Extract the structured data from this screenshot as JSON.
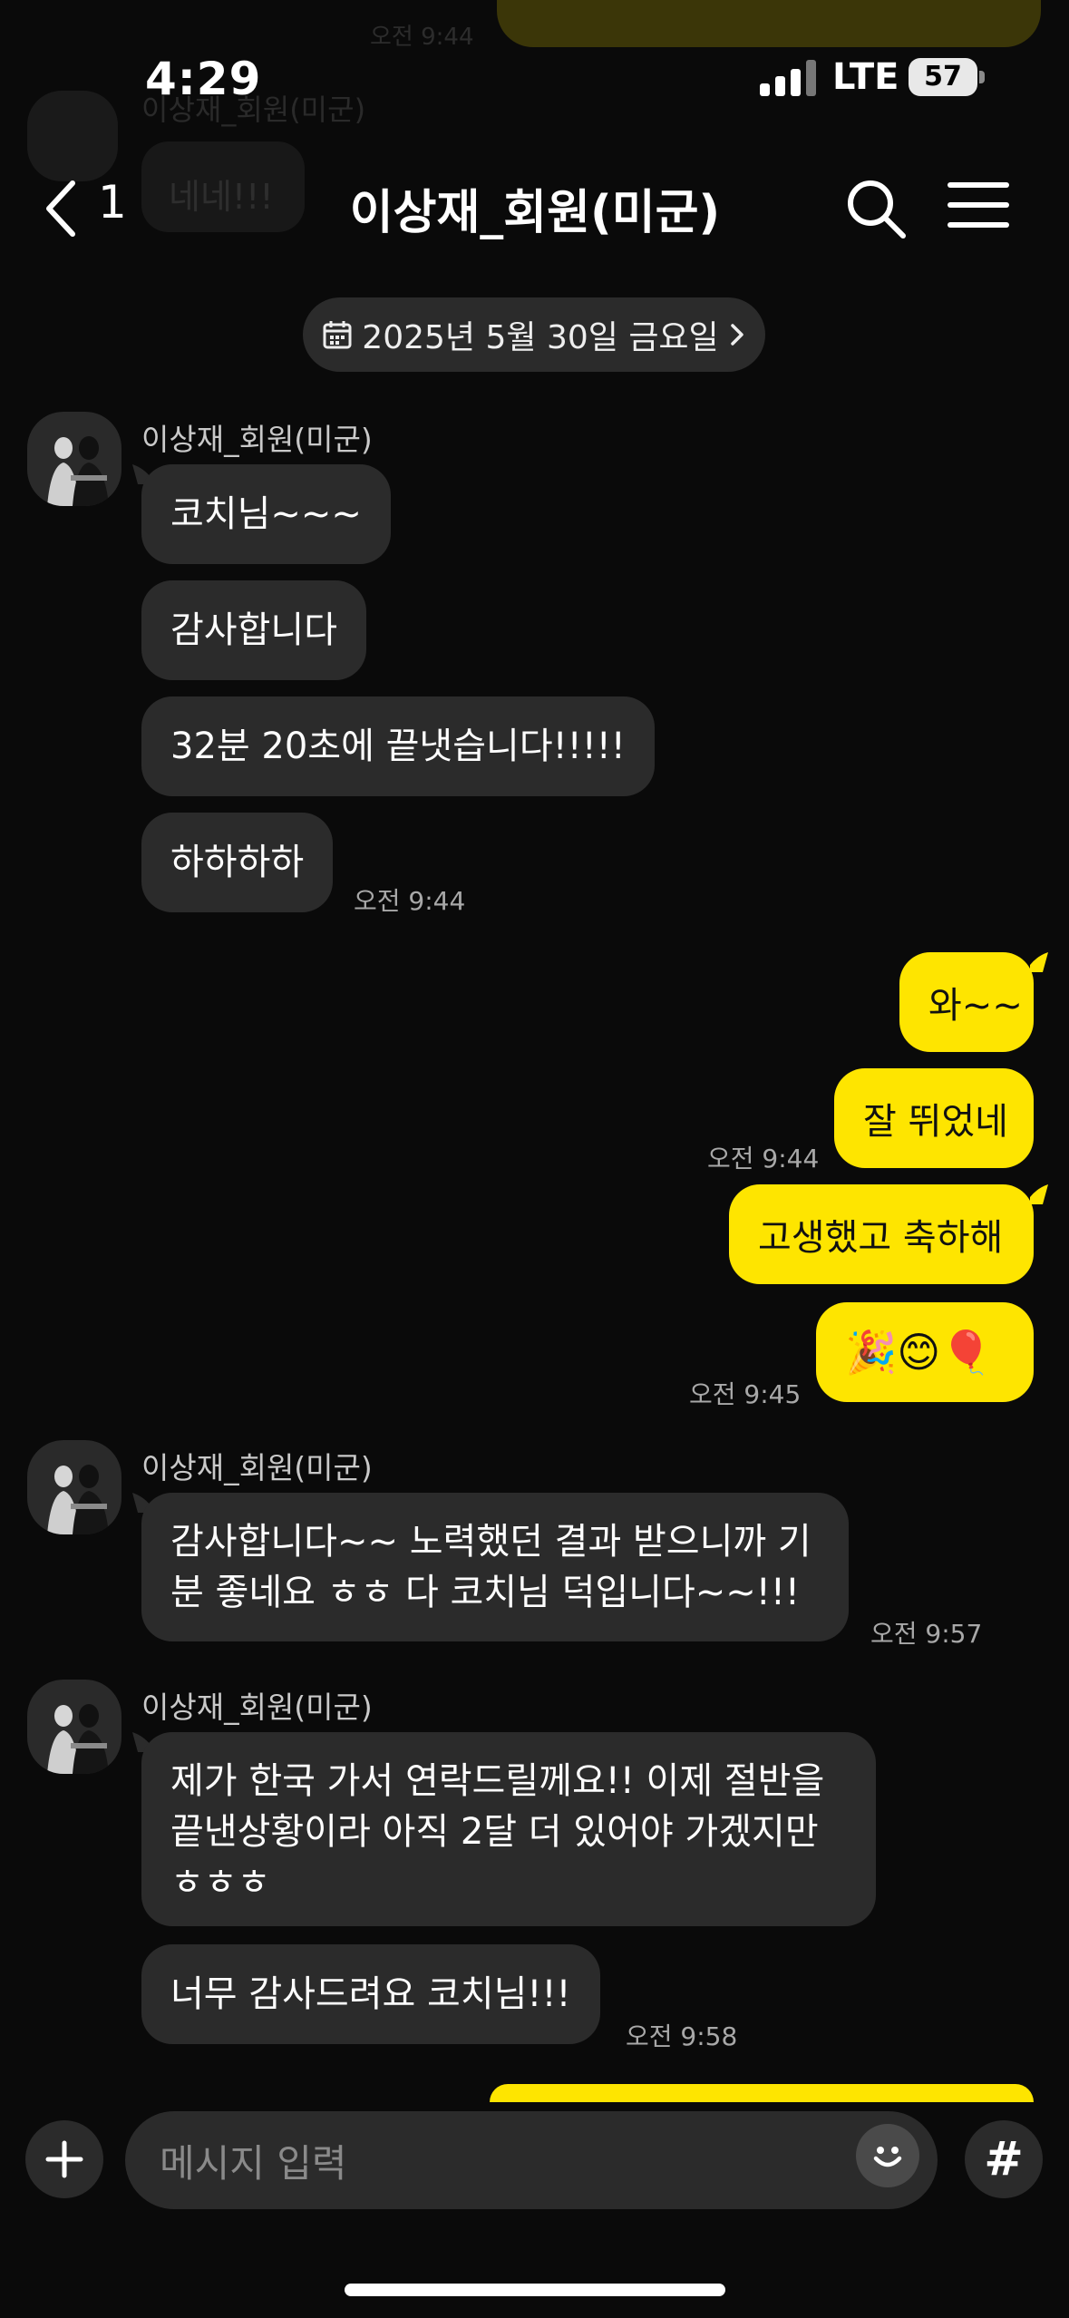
{
  "ghost": {
    "time": "오전 9:44",
    "name": "이상재_회원(미군)",
    "message": "네네!!!"
  },
  "status_bar": {
    "time": "4:29",
    "network": "LTE",
    "battery": "57"
  },
  "header": {
    "back_count": "1",
    "title": "이상재_회원(미군)"
  },
  "date_divider": "2025년 5월 30일 금요일",
  "messages": {
    "group1": {
      "sender": "이상재_회원(미군)",
      "bubbles": [
        "코치님~~~",
        "감사합니다",
        "32분 20초에 끝냇습니다!!!!!",
        "하하하하"
      ],
      "time": "오전 9:44"
    },
    "group2": {
      "bubbles": [
        "와~~",
        "잘 뛰었네"
      ],
      "time": "오전 9:44"
    },
    "group3": {
      "bubbles": [
        "고생했고 축하해",
        "🎉😊🎈"
      ],
      "time": "오전 9:45"
    },
    "group4": {
      "sender": "이상재_회원(미군)",
      "bubble": "감사합니다~~ 노력했던 결과 받으니까 기분 좋네요 ㅎㅎ 다 코치님 덕입니다~~!!!",
      "time": "오전 9:57"
    },
    "group5": {
      "sender": "이상재_회원(미군)",
      "bubbles": [
        "제가 한국 가서 연락드릴께요!! 이제 절반을 끝낸상황이라 아직 2달 더 있어야 가겠지만 ㅎㅎㅎ",
        "너무 감사드려요 코치님!!!"
      ],
      "time": "오전 9:58"
    }
  },
  "input": {
    "placeholder": "메시지 입력",
    "hash": "#"
  },
  "colors": {
    "background": "#0a0a0a",
    "incoming_bubble": "#2b2b2b",
    "outgoing_bubble": "#fee500"
  },
  "icons": [
    "calendar-icon",
    "chevron-right-icon",
    "back-chevron-icon",
    "search-icon",
    "menu-icon",
    "plus-icon",
    "emoji-icon",
    "hash-icon"
  ]
}
